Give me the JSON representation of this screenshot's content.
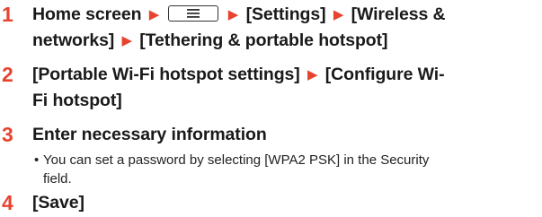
{
  "steps": [
    {
      "number": "1",
      "line1_a": "Home screen",
      "menu_icon": "menu-key-icon",
      "line1_b": "[Settings]",
      "line1_c": "[Wireless &",
      "line2_a": "networks]",
      "line2_b": "[Tethering & portable hotspot]"
    },
    {
      "number": "2",
      "line1_a": "[Portable Wi-Fi hotspot settings]",
      "line1_b": "[Configure Wi-",
      "line2_a": "Fi hotspot]"
    },
    {
      "number": "3",
      "text": "Enter necessary information",
      "note_bullet": "•",
      "note_line1": "You can set a password by selecting [WPA2 PSK] in the Security",
      "note_line2": "field."
    },
    {
      "number": "4",
      "text": "[Save]"
    }
  ],
  "colors": {
    "accent": "#e8432e",
    "text": "#1a1a1a"
  }
}
